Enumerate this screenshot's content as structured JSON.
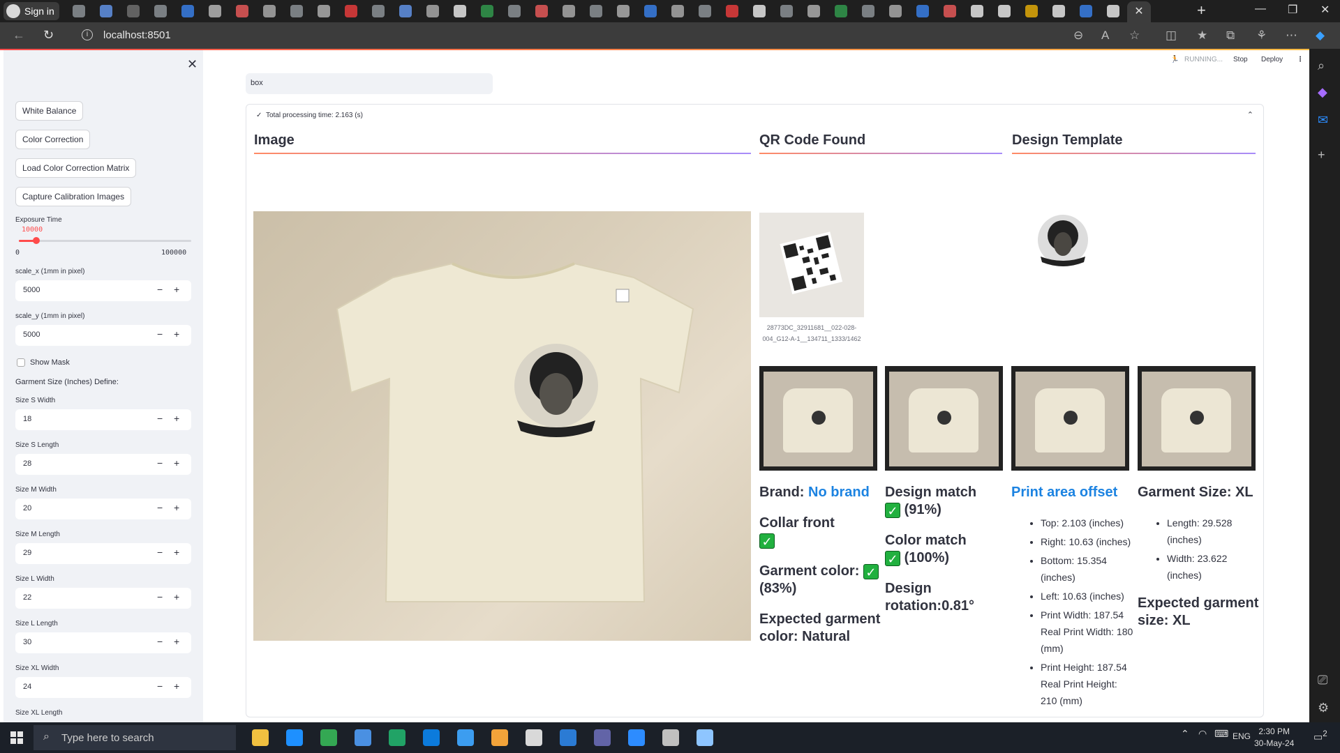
{
  "browser": {
    "signin_label": "Sign in",
    "url": "localhost:8501",
    "active_tab_close": "✕",
    "new_tab": "+"
  },
  "status": {
    "running": "RUNNING...",
    "stop": "Stop",
    "deploy": "Deploy"
  },
  "sidebar": {
    "buttons": [
      "White Balance",
      "Color Correction",
      "Load Color Correction Matrix",
      "Capture Calibration Images"
    ],
    "exposure": {
      "label": "Exposure Time",
      "value": "10000",
      "min": "0",
      "max": "100000",
      "fraction": 0.1
    },
    "scale_x": {
      "label": "scale_x (1mm in pixel)",
      "value": "5000"
    },
    "scale_y": {
      "label": "scale_y (1mm in pixel)",
      "value": "5000"
    },
    "show_mask": "Show Mask",
    "garment_section": "Garment Size (Inches) Define:",
    "sizes": [
      {
        "label": "Size S Width",
        "value": "18"
      },
      {
        "label": "Size S Length",
        "value": "28"
      },
      {
        "label": "Size M Width",
        "value": "20"
      },
      {
        "label": "Size M Length",
        "value": "29"
      },
      {
        "label": "Size L Width",
        "value": "22"
      },
      {
        "label": "Size L Length",
        "value": "30"
      },
      {
        "label": "Size XL Width",
        "value": "24"
      },
      {
        "label": "Size XL Length",
        "value": ""
      }
    ]
  },
  "main": {
    "search_value": "box",
    "expander_title": "Total processing time: 2.163 (s)",
    "col_image": "Image",
    "col_qr": "QR Code Found",
    "col_template": "Design Template",
    "qr_caption": "28773DC_32911681__022-028-004_G12-A-1__134711_1333/1462",
    "brand_label": "Brand:",
    "brand_value": "No brand",
    "collar": "Collar front",
    "garment_color_label": "Garment color:",
    "garment_color_pct": "(83%)",
    "expected_color": "Expected garment color: Natural",
    "design_match_label": "Design match",
    "design_match_pct": "(91%)",
    "color_match_label": "Color match",
    "color_match_pct": "(100%)",
    "design_rotation": "Design rotation:0.81°",
    "print_offset_title": "Print area offset",
    "offsets": [
      "Top: 2.103 (inches)",
      "Right: 10.63 (inches)",
      "Bottom: 15.354 (inches)",
      "Left: 10.63 (inches)",
      "Print Width: 187.54 Real Print Width: 180 (mm)",
      "Print Height: 187.54 Real Print Height: 210 (mm)"
    ],
    "garment_size_title": "Garment Size: XL",
    "garment_dims": [
      "Length: 29.528 (inches)",
      "Width: 23.622 (inches)"
    ],
    "expected_size": "Expected garment size: XL",
    "check_glyph": "✓"
  },
  "taskbar": {
    "search_placeholder": "Type here to search",
    "lang": "ENG",
    "time": "2:30 PM",
    "date": "30-May-24",
    "notif_count": "2"
  }
}
